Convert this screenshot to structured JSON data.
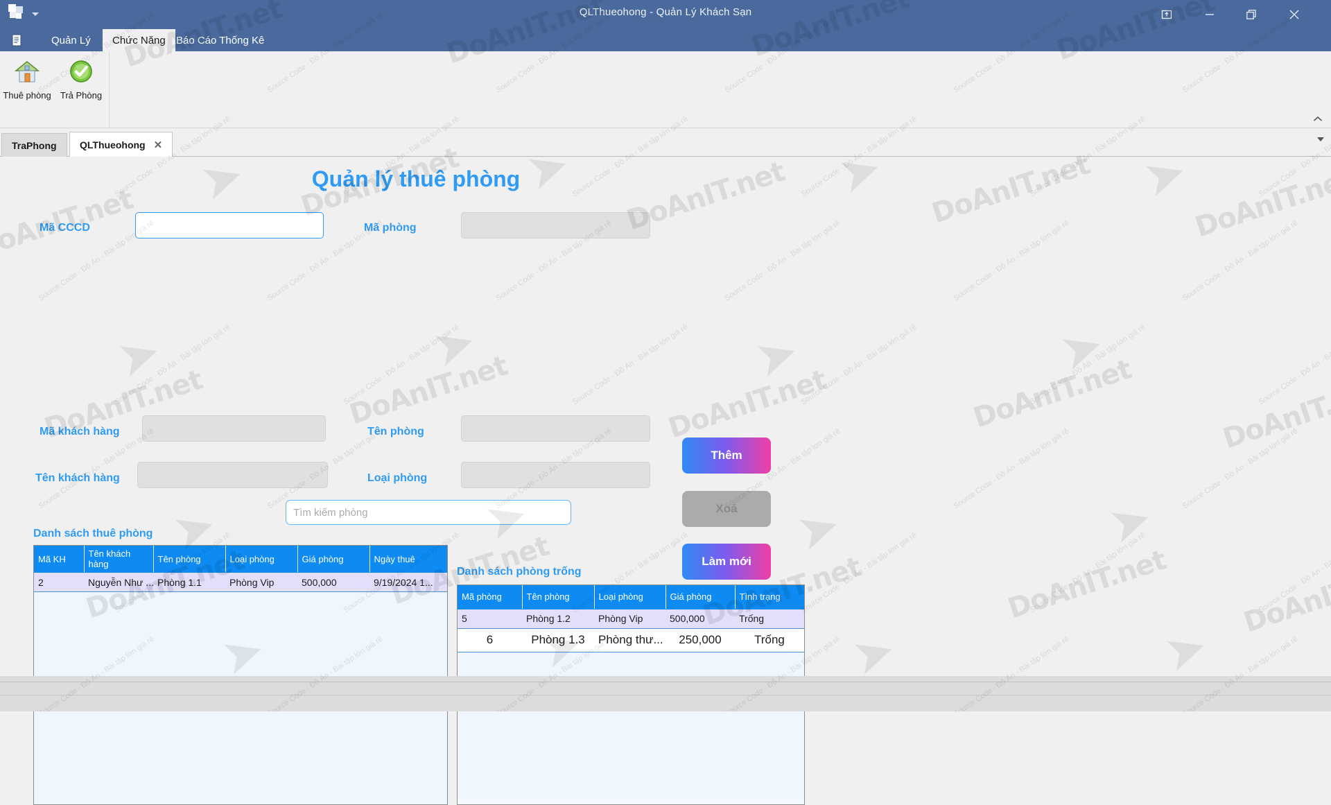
{
  "window": {
    "title": "QLThueohong - Quản Lý Khách Sạn",
    "controls": {
      "restore_icon": "restore-window-icon",
      "minimize_icon": "minimize-icon",
      "maximize_icon": "maximize-icon",
      "close_icon": "close-icon"
    },
    "quick_access": {
      "logo_icon": "office-logo-icon",
      "caret_icon": "chevron-down-icon"
    }
  },
  "ribbon": {
    "file_icon": "file-menu-icon",
    "tabs": [
      {
        "label": "Quản Lý",
        "active": false
      },
      {
        "label": "Chức Năng",
        "active": true
      },
      {
        "label": "Báo Cáo Thống Kê",
        "active": false
      }
    ],
    "collapse_icon": "chevron-up-icon",
    "group_items": [
      {
        "label": "Thuê phòng",
        "icon": "home-icon"
      },
      {
        "label": "Trả Phòng",
        "icon": "check-circle-icon"
      }
    ]
  },
  "doc_tabs": {
    "items": [
      {
        "label": "TraPhong",
        "active": false,
        "closable": false
      },
      {
        "label": "QLThueohong",
        "active": true,
        "closable": true,
        "close_glyph": "✕"
      }
    ],
    "overflow_icon": "chevron-down-icon"
  },
  "form": {
    "title": "Quản lý thuê phòng",
    "left_fields": [
      {
        "label": "Mã CCCD",
        "value": "",
        "focused": true
      },
      {
        "label": "Mã khách hàng",
        "value": "",
        "focused": false
      },
      {
        "label": "Tên khách hàng",
        "value": "",
        "focused": false
      }
    ],
    "right_fields": [
      {
        "label": "Mã phòng",
        "value": "",
        "focused": false
      },
      {
        "label": "Tên phòng",
        "value": "",
        "focused": false
      },
      {
        "label": "Loại phòng",
        "value": "",
        "focused": false
      }
    ],
    "search": {
      "placeholder": "Tìm kiếm phòng",
      "value": ""
    },
    "buttons": [
      {
        "label": "Thêm",
        "state": "enabled"
      },
      {
        "label": "Xoá",
        "state": "disabled"
      },
      {
        "label": "Làm mới",
        "state": "enabled"
      }
    ]
  },
  "rent_list": {
    "title": "Danh sách thuê phòng",
    "columns": [
      "Mã KH",
      "Tên khách hàng",
      "Tên phòng",
      "Loại phòng",
      "Giá phòng",
      "Ngày thuê"
    ],
    "rows": [
      {
        "state": "selected",
        "cells": [
          "2",
          "Nguyễn Như ...",
          "Phòng 1.1",
          "Phòng Vip",
          "500,000",
          "9/19/2024 1..."
        ]
      }
    ]
  },
  "empty_rooms": {
    "title": "Danh sách phòng trống",
    "columns": [
      "Mã phòng",
      "Tên phòng",
      "Loại phòng",
      "Giá phòng",
      "Tình trạng"
    ],
    "rows": [
      {
        "state": "selected",
        "cells": [
          "5",
          "Phòng 1.2",
          "Phòng Vip",
          "500,000",
          "Trống"
        ]
      },
      {
        "state": "hovered",
        "cells": [
          "6",
          "Phòng 1.3",
          "Phòng thư...",
          "250,000",
          "Trống"
        ]
      }
    ]
  },
  "colors": {
    "titlebar": "#4a6a9e",
    "accent_blue": "#2f9bf5",
    "grid_header": "#0d8bf2",
    "selected_row": "#e3defa",
    "grid_body": "#eff6fd",
    "button_gradient_start": "#2f8bf5",
    "button_gradient_end": "#ef3fa4",
    "disabled_button": "#ababab"
  },
  "watermark": {
    "brand": "DoAnIT.net",
    "tagline": "Source Code - Đồ Án - Bài tập lớn giá rẻ"
  }
}
